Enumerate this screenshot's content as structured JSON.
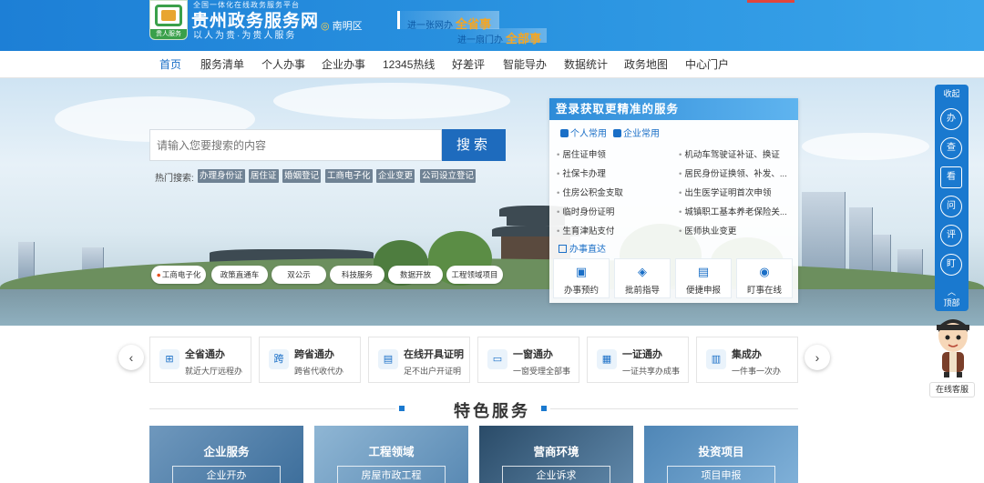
{
  "header": {
    "logo_top": "全国一体化在线政务服务平台",
    "logo_badge": "贵人服务",
    "title": "贵州政务服务网",
    "slogan": "以人为贵·为贵人服务",
    "location": "南明区",
    "banner1_text": "进一张网办",
    "banner1_em": "全省事",
    "banner2_text": "进一扇门办",
    "banner2_em": "全部事"
  },
  "nav": [
    "首页",
    "服务清单",
    "个人办事",
    "企业办事",
    "12345热线",
    "好差评",
    "智能导办",
    "数据统计",
    "政务地图",
    "中心门户"
  ],
  "search": {
    "placeholder": "请输入您要搜索的内容",
    "button": "搜索",
    "hot_label": "热门搜索:",
    "hot_tags": [
      "办理身份证",
      "居住证",
      "婚姻登记",
      "工商电子化",
      "企业变更",
      "公司设立登记"
    ]
  },
  "pills": [
    "工商电子化",
    "政策直通车",
    "双公示",
    "科技服务",
    "数据开放",
    "工程领域项目"
  ],
  "panel": {
    "title": "登录获取更精准的服务",
    "tab_personal": "个人常用",
    "tab_enterprise": "企业常用",
    "left_items": [
      "居住证申领",
      "社保卡办理",
      "住房公积金支取",
      "临时身份证明",
      "生育津贴支付"
    ],
    "right_items": [
      "机动车驾驶证补证、换证",
      "居民身份证换领、补发、...",
      "出生医学证明首次申领",
      "城镇职工基本养老保险关...",
      "医师执业变更"
    ],
    "direct": "办事直达",
    "buttons": [
      "办事预约",
      "批前指导",
      "便捷申报",
      "盯事在线"
    ]
  },
  "rail": {
    "top": "收起",
    "items": [
      "办",
      "查",
      "看",
      "问",
      "评",
      "盯"
    ],
    "bottom": "顶部"
  },
  "services": [
    {
      "title": "全省通办",
      "sub": "就近大厅远程办",
      "icon": "network-icon"
    },
    {
      "title": "跨省通办",
      "sub": "跨省代收代办",
      "icon": "cross-province-icon"
    },
    {
      "title": "在线开具证明",
      "sub": "足不出户开证明",
      "icon": "certificate-icon"
    },
    {
      "title": "一窗通办",
      "sub": "一窗受理全部事",
      "icon": "window-icon"
    },
    {
      "title": "一证通办",
      "sub": "一证共享办成事",
      "icon": "id-card-icon"
    },
    {
      "title": "集成办",
      "sub": "一件事一次办",
      "icon": "integrated-icon"
    }
  ],
  "section_title": "特色服务",
  "features": [
    {
      "title": "企业服务",
      "sub": "企业开办"
    },
    {
      "title": "工程领域",
      "sub": "房屋市政工程"
    },
    {
      "title": "营商环境",
      "sub": "企业诉求"
    },
    {
      "title": "投资项目",
      "sub": "项目申报"
    }
  ],
  "online_service": "在线客服",
  "colors": {
    "primary": "#1a79cf",
    "accent": "#f5a623",
    "nav_active": "#1a6fc7"
  }
}
